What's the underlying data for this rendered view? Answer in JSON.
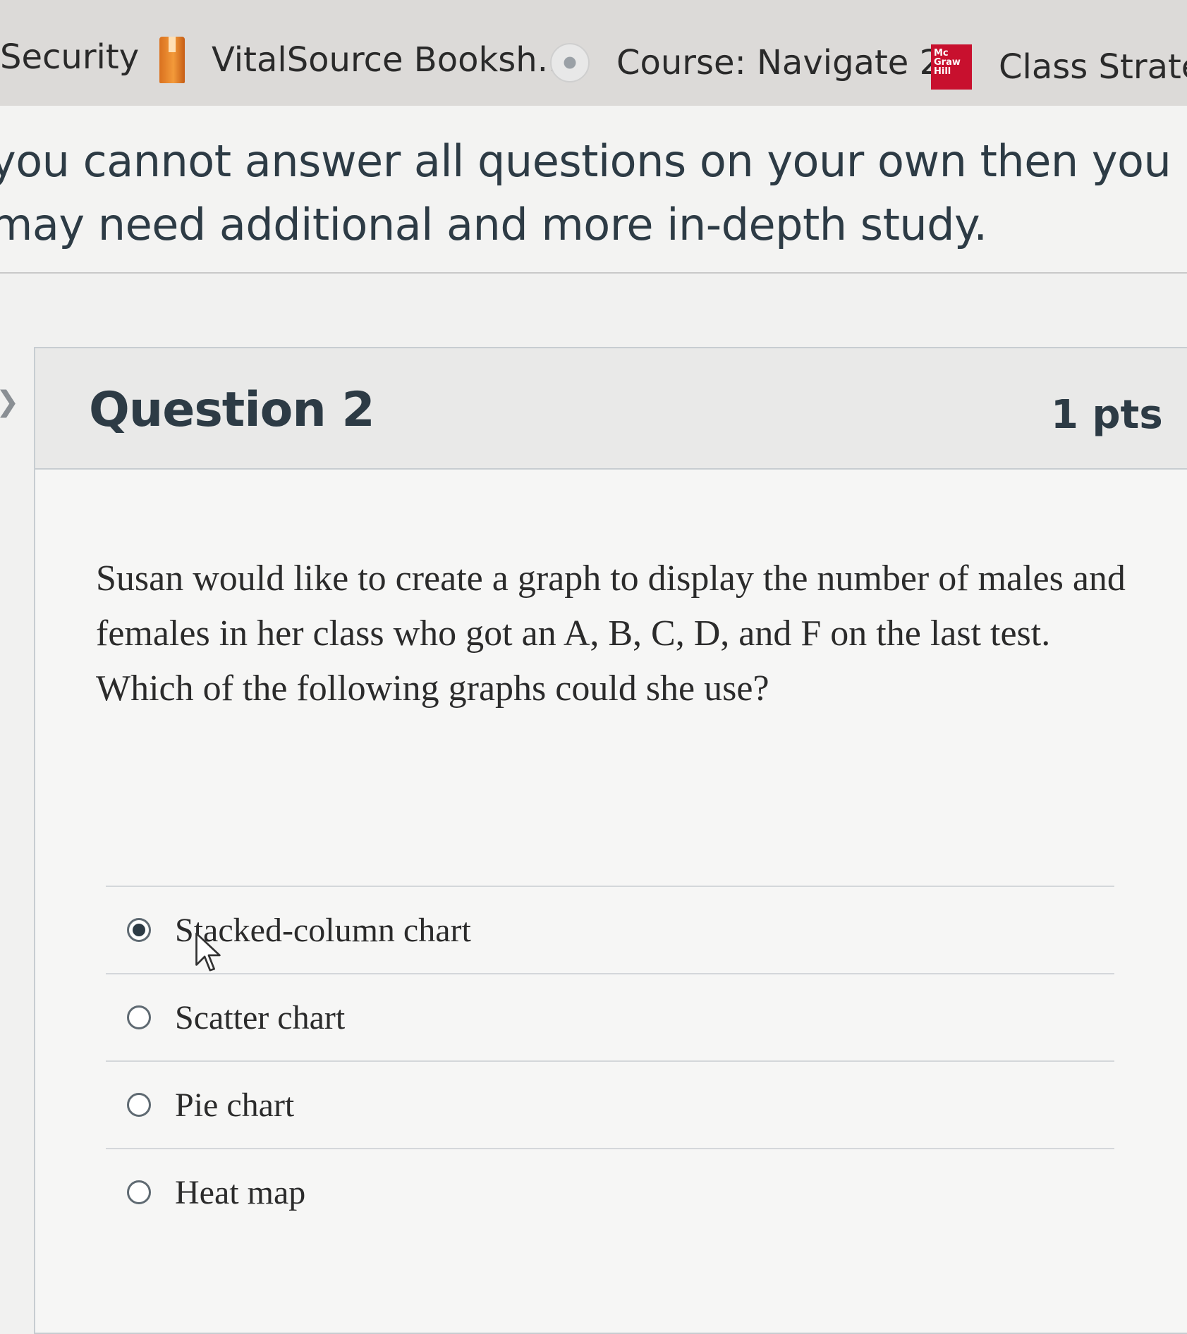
{
  "bookmarks": [
    {
      "label": "Security",
      "icon": "none"
    },
    {
      "label": "VitalSource Booksh...",
      "icon": "book-icon"
    },
    {
      "label": "Course: Navigate 2...",
      "icon": "globe-icon"
    },
    {
      "label": "Class Strategic",
      "icon": "mcgraw-hill-icon",
      "icon_text": "Mc\nGraw\nHill"
    }
  ],
  "intro": {
    "text": "you cannot answer all questions on your own then you may need additional and more in-depth study."
  },
  "question": {
    "title": "Question 2",
    "points": "1 pts",
    "text": "Susan would like to create a graph to display the number of males and females in her class who got an A, B, C, D, and F on the last test. Which of the following graphs could she use?",
    "options": [
      {
        "label": "Stacked-column chart",
        "selected": true
      },
      {
        "label": "Scatter chart",
        "selected": false
      },
      {
        "label": "Pie chart",
        "selected": false
      },
      {
        "label": "Heat map",
        "selected": false
      }
    ]
  },
  "colors": {
    "text": "#2d3b45",
    "accent_red": "#c8102e",
    "book_orange": "#f39a3a"
  }
}
